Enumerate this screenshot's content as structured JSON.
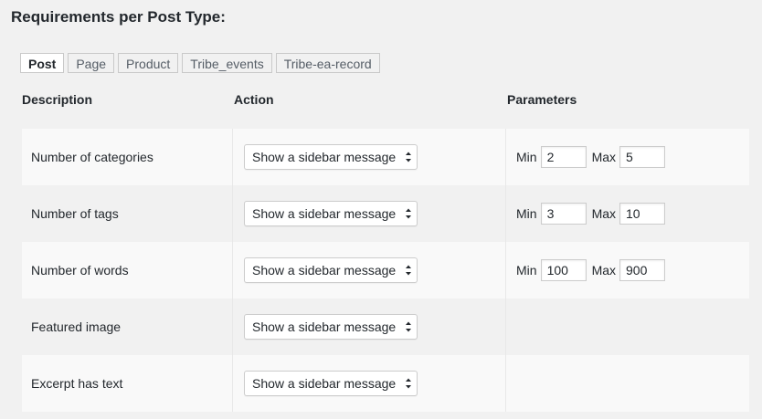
{
  "title": "Requirements per Post Type:",
  "tabs": [
    {
      "label": "Post",
      "active": true
    },
    {
      "label": "Page",
      "active": false
    },
    {
      "label": "Product",
      "active": false
    },
    {
      "label": "Tribe_events",
      "active": false
    },
    {
      "label": "Tribe-ea-record",
      "active": false
    }
  ],
  "columns": {
    "description": "Description",
    "action": "Action",
    "parameters": "Parameters"
  },
  "rows": [
    {
      "description": "Number of categories",
      "action": "Show a sidebar message",
      "min_label": "Min",
      "min": "2",
      "max_label": "Max",
      "max": "5"
    },
    {
      "description": "Number of tags",
      "action": "Show a sidebar message",
      "min_label": "Min",
      "min": "3",
      "max_label": "Max",
      "max": "10"
    },
    {
      "description": "Number of words",
      "action": "Show a sidebar message",
      "min_label": "Min",
      "min": "100",
      "max_label": "Max",
      "max": "900"
    },
    {
      "description": "Featured image",
      "action": "Show a sidebar message"
    },
    {
      "description": "Excerpt has text",
      "action": "Show a sidebar message"
    }
  ],
  "colors": {
    "background": "#f1f1f1",
    "row_alt": "#f9f9f9",
    "tab_text": "#555d66",
    "text": "#23282d"
  }
}
